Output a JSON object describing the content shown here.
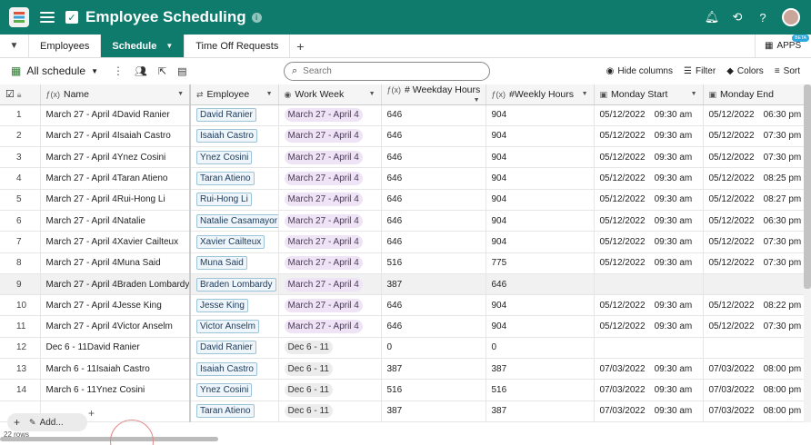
{
  "app": {
    "title": "Employee Scheduling",
    "colors": {
      "header": "#0f7b6c",
      "employee_pill": "#eef5fb",
      "week_pill": "#efe4f5"
    }
  },
  "tabs": [
    {
      "label": "Employees",
      "active": false
    },
    {
      "label": "Schedule",
      "active": true
    },
    {
      "label": "Time Off Requests",
      "active": false
    }
  ],
  "apps_label": "APPS",
  "apps_badge": "BETA",
  "toolbar": {
    "view_name": "All schedule",
    "search_placeholder": "Search",
    "hide_columns": "Hide columns",
    "filter": "Filter",
    "colors": "Colors",
    "sort": "Sort"
  },
  "columns": {
    "name": "Name",
    "employee": "Employee",
    "work_week": "Work Week",
    "weekday_hours": "# Weekday Hours",
    "weekly_hours": "#Weekly Hours",
    "monday_start": "Monday Start",
    "monday_end": "Monday End"
  },
  "rows": [
    {
      "num": "1",
      "name": "March 27 - April 4David Ranier",
      "employee": "David Ranier",
      "week": "March 27 - April 4",
      "weekday_hours": "646",
      "weekly_hours": "904",
      "start_date": "05/12/2022",
      "start_time": "09:30 am",
      "end_date": "05/12/2022",
      "end_time": "06:30 pm"
    },
    {
      "num": "2",
      "name": "March 27 - April 4Isaiah Castro",
      "employee": "Isaiah Castro",
      "week": "March 27 - April 4",
      "weekday_hours": "646",
      "weekly_hours": "904",
      "start_date": "05/12/2022",
      "start_time": "09:30 am",
      "end_date": "05/12/2022",
      "end_time": "07:30 pm"
    },
    {
      "num": "3",
      "name": "March 27 - April 4Ynez Cosini",
      "employee": "Ynez Cosini",
      "week": "March 27 - April 4",
      "weekday_hours": "646",
      "weekly_hours": "904",
      "start_date": "05/12/2022",
      "start_time": "09:30 am",
      "end_date": "05/12/2022",
      "end_time": "07:30 pm"
    },
    {
      "num": "4",
      "name": "March 27 - April 4Taran Atieno",
      "employee": "Taran Atieno",
      "week": "March 27 - April 4",
      "weekday_hours": "646",
      "weekly_hours": "904",
      "start_date": "05/12/2022",
      "start_time": "09:30 am",
      "end_date": "05/12/2022",
      "end_time": "08:25 pm"
    },
    {
      "num": "5",
      "name": "March 27 - April 4Rui-Hong Li",
      "employee": "Rui-Hong Li",
      "week": "March 27 - April 4",
      "weekday_hours": "646",
      "weekly_hours": "904",
      "start_date": "05/12/2022",
      "start_time": "09:30 am",
      "end_date": "05/12/2022",
      "end_time": "08:27 pm"
    },
    {
      "num": "6",
      "name": "March 27 - April 4Natalie",
      "employee": "Natalie Casamayor",
      "week": "March 27 - April 4",
      "weekday_hours": "646",
      "weekly_hours": "904",
      "start_date": "05/12/2022",
      "start_time": "09:30 am",
      "end_date": "05/12/2022",
      "end_time": "06:30 pm"
    },
    {
      "num": "7",
      "name": "March 27 - April 4Xavier Cailteux",
      "employee": "Xavier Cailteux",
      "week": "March 27 - April 4",
      "weekday_hours": "646",
      "weekly_hours": "904",
      "start_date": "05/12/2022",
      "start_time": "09:30 am",
      "end_date": "05/12/2022",
      "end_time": "07:30 pm"
    },
    {
      "num": "8",
      "name": "March 27 - April 4Muna Said",
      "employee": "Muna Said",
      "week": "March 27 - April 4",
      "weekday_hours": "516",
      "weekly_hours": "775",
      "start_date": "05/12/2022",
      "start_time": "09:30 am",
      "end_date": "05/12/2022",
      "end_time": "07:30 pm"
    },
    {
      "num": "9",
      "name": "March 27 - April 4Braden Lombardy",
      "employee": "Braden Lombardy",
      "week": "March 27 - April 4",
      "weekday_hours": "387",
      "weekly_hours": "646",
      "start_date": "",
      "start_time": "",
      "end_date": "",
      "end_time": ""
    },
    {
      "num": "10",
      "name": "March 27 - April 4Jesse King",
      "employee": "Jesse King",
      "week": "March 27 - April 4",
      "weekday_hours": "646",
      "weekly_hours": "904",
      "start_date": "05/12/2022",
      "start_time": "09:30 am",
      "end_date": "05/12/2022",
      "end_time": "08:22 pm"
    },
    {
      "num": "11",
      "name": "March 27 - April 4Victor Anselm",
      "employee": "Victor Anselm",
      "week": "March 27 - April 4",
      "weekday_hours": "646",
      "weekly_hours": "904",
      "start_date": "05/12/2022",
      "start_time": "09:30 am",
      "end_date": "05/12/2022",
      "end_time": "07:30 pm"
    },
    {
      "num": "12",
      "name": "Dec 6 - 11David Ranier",
      "employee": "David Ranier",
      "week": "Dec 6 - 11",
      "weekday_hours": "0",
      "weekly_hours": "0",
      "start_date": "",
      "start_time": "",
      "end_date": "",
      "end_time": ""
    },
    {
      "num": "13",
      "name": "March 6 - 11Isaiah Castro",
      "employee": "Isaiah Castro",
      "week": "Dec 6 - 11",
      "weekday_hours": "387",
      "weekly_hours": "387",
      "start_date": "07/03/2022",
      "start_time": "09:30 am",
      "end_date": "07/03/2022",
      "end_time": "08:00 pm"
    },
    {
      "num": "14",
      "name": "March 6 - 11Ynez Cosini",
      "employee": "Ynez Cosini",
      "week": "Dec 6 - 11",
      "weekday_hours": "516",
      "weekly_hours": "516",
      "start_date": "07/03/2022",
      "start_time": "09:30 am",
      "end_date": "07/03/2022",
      "end_time": "08:00 pm"
    },
    {
      "num": "",
      "name": "",
      "employee": "Taran Atieno",
      "week": "Dec 6 - 11",
      "weekday_hours": "387",
      "weekly_hours": "387",
      "start_date": "07/03/2022",
      "start_time": "09:30 am",
      "end_date": "07/03/2022",
      "end_time": "08:00 pm"
    }
  ],
  "footer": {
    "add_label": "Add...",
    "rows_count": "22 rows"
  }
}
